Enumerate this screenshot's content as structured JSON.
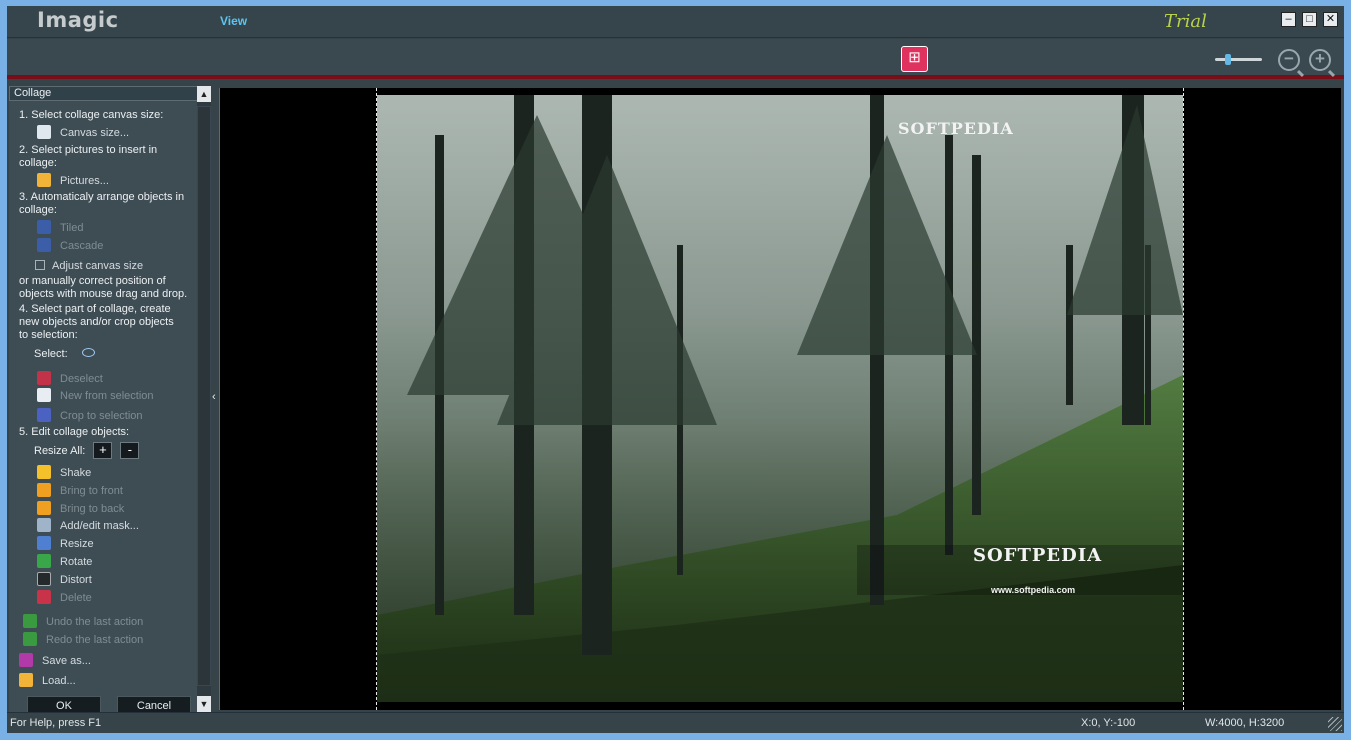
{
  "app": {
    "title": "Imagic",
    "trial_label": "Trial"
  },
  "menu": {
    "view": "View"
  },
  "window_controls": {
    "minimize": "–",
    "maximize": "□",
    "close": "✕"
  },
  "toolbar": {
    "center_icon": "collage-icon",
    "zoom_out": "zoom-out-icon",
    "zoom_in": "zoom-in-icon"
  },
  "panel": {
    "title": "Collage",
    "step1": "1. Select collage canvas size:",
    "canvas_size": "Canvas size...",
    "step2a": "2. Select pictures to insert in",
    "step2b": "collage:",
    "pictures": "Pictures...",
    "step3a": "3. Automaticaly arrange objects in",
    "step3b": "collage:",
    "tiled": "Tiled",
    "cascade": "Cascade",
    "adjust_canvas": "Adjust canvas size",
    "manual_a": "or manually correct position of",
    "manual_b": "objects with mouse drag and drop.",
    "step4a": "4. Select part of collage, create",
    "step4b": "new objects and/or crop objects",
    "step4c": "to selection:",
    "select_label": "Select:",
    "deselect": "Deselect",
    "new_from_selection": "New  from selection",
    "crop_to_selection": "Crop to selection",
    "step5": "5. Edit collage objects:",
    "resize_all": "Resize All:",
    "plus": "+",
    "minus": "-",
    "shake": "Shake",
    "bring_to_front": "Bring to front",
    "bring_to_back": "Bring to back",
    "add_edit_mask": "Add/edit mask...",
    "resize": "Resize",
    "rotate": "Rotate",
    "distort": "Distort",
    "delete": "Delete",
    "undo": "Undo the last action",
    "redo": "Redo the last action",
    "save_as": "Save as...",
    "load": "Load...",
    "ok": "OK",
    "cancel": "Cancel"
  },
  "watermark": {
    "top": "SOFTPEDIA",
    "bottom": "SOFTPEDIA",
    "url": "www.softpedia.com",
    "reg": "®"
  },
  "status": {
    "help": "For Help, press F1",
    "coords": "X:0, Y:-100",
    "size": "W:4000, H:3200"
  }
}
